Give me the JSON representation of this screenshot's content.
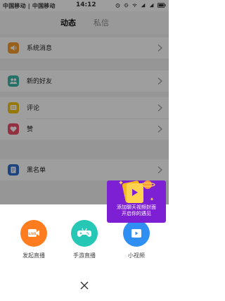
{
  "status_bar": {
    "carriers": "中国移动 | 中国移动",
    "time": "14:12"
  },
  "tabs": [
    {
      "label": "动态"
    },
    {
      "label": "私信"
    }
  ],
  "list": [
    {
      "label": "系统消息",
      "color": "#f59b2b"
    },
    {
      "label": "新的好友",
      "color": "#3db6a7"
    },
    {
      "label": "评论",
      "color": "#f2c30f"
    },
    {
      "label": "赞",
      "color": "#ef4f6a"
    },
    {
      "label": "黑名单",
      "color": "#2f6fd1"
    }
  ],
  "sheet": {
    "actions": [
      {
        "label": "发起直播",
        "color": "#ff7d1f",
        "icon": "live-icon"
      },
      {
        "label": "手游直播",
        "color": "#26c7b5",
        "icon": "gamepad-icon"
      },
      {
        "label": "小视频",
        "color": "#2f8ff3",
        "icon": "video-icon"
      }
    ]
  },
  "promo": {
    "line1": "添加聊天视频封面",
    "line2": "开启你的遇见",
    "color": "#7d1fd3"
  }
}
